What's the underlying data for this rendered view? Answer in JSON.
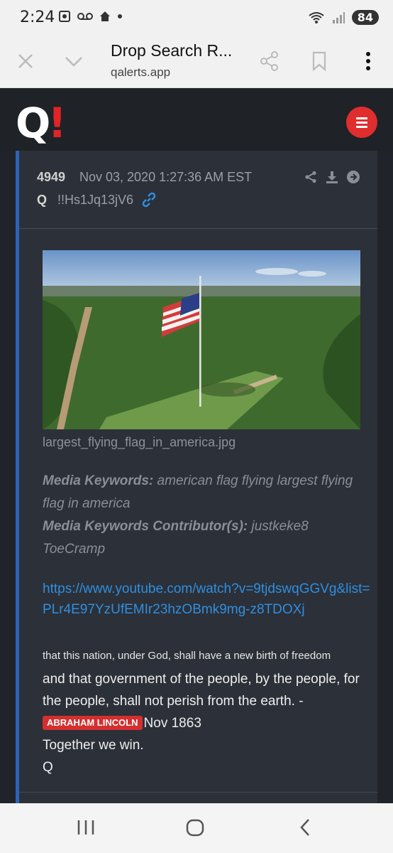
{
  "status": {
    "time": "2:24",
    "battery": "84"
  },
  "browser": {
    "title": "Drop Search R...",
    "url": "qalerts.app"
  },
  "post": {
    "number": "4949",
    "date": "Nov 03, 2020 1:27:36 AM EST",
    "author": "Q",
    "tripcode": "!!Hs1Jq13jV6",
    "filename": "largest_flying_flag_in_america.jpg",
    "keywords_label": "Media Keywords:",
    "keywords_value": "american flag flying largest flying flag in america",
    "contrib_label": "Media Keywords Contributor(s):",
    "contrib_value": "justkeke8 ToeCramp",
    "link": "https://www.youtube.com/watch?v=9tjdswqGGVg&list=PLr4E97YzUfEMIr23hzOBmk9mg-z8TDOXj",
    "line1": "that this nation, under God, shall have a new birth of freedom",
    "line2": "and that government of the people, by the people, for the people, shall not perish from the earth. -",
    "tag": "ABRAHAM LINCOLN",
    "line3": "Nov 1863",
    "line4": "Together we win.",
    "sign": "Q"
  },
  "colors": {
    "accent": "#e02d2d",
    "link": "#2f8fe0",
    "border": "#2a63b8"
  }
}
